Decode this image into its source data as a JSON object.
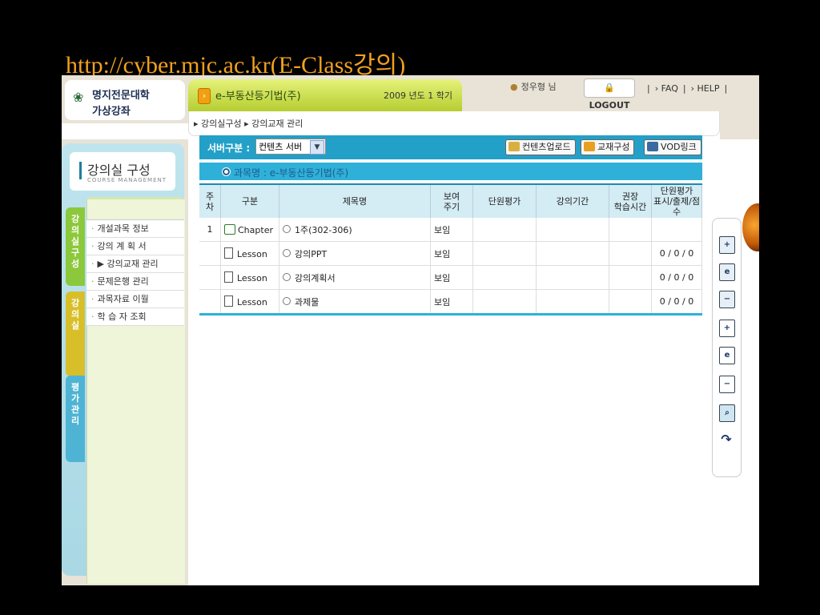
{
  "slide_title": "http://cyber.mjc.ac.kr(E-Class강의)",
  "logo": {
    "line1": "명지전문대학",
    "line2": "가상강좌"
  },
  "course": {
    "name": "e-부동산등기법(주)",
    "semester": "2009 년도 1 학기"
  },
  "user": {
    "name": "정우형 님"
  },
  "header_links": {
    "logout": "LOGOUT",
    "faq": "› FAQ",
    "help": "› HELP"
  },
  "breadcrumb": "▸ 강의실구성 ▸ 강의교재 관리",
  "sidebar": {
    "title": "강의실 구성",
    "subtitle": "COURSE MANAGEMENT",
    "vtabs": [
      "강의실구성",
      "강의실",
      "평가관리"
    ],
    "items": [
      "개설과목 정보",
      "강의 계 획 서",
      "▶ 강의교재 관리",
      "문제은행 관리",
      "과목자료 이월",
      "학 습 자 조회"
    ]
  },
  "server": {
    "label": "서버구분 :",
    "selected": "컨텐츠 서버"
  },
  "buttons": {
    "upload": "컨텐츠업로드",
    "compose": "교재구성",
    "vod": "VOD링크"
  },
  "subject": "과목명 : e-부동산등기법(주)",
  "table": {
    "headers": [
      "주\n차",
      "구분",
      "제목명",
      "보여\n주기",
      "단원평가",
      "강의기간",
      "권장\n학습시간",
      "단원평가\n표시/출제/점수"
    ],
    "rows": [
      {
        "week": "1",
        "type": "Chapter",
        "title": "1주(302-306)",
        "show": "보임",
        "score": ""
      },
      {
        "week": "",
        "type": "Lesson",
        "title": "강의PPT",
        "show": "보임",
        "score": "0 / 0 / 0"
      },
      {
        "week": "",
        "type": "Lesson",
        "title": "강의계획서",
        "show": "보임",
        "score": "0 / 0 / 0"
      },
      {
        "week": "",
        "type": "Lesson",
        "title": "과제물",
        "show": "보임",
        "score": "0 / 0 / 0"
      }
    ]
  },
  "tools": [
    "folder-add-icon",
    "folder-edit-icon",
    "folder-remove-icon",
    "doc-add-icon",
    "doc-edit-icon",
    "doc-remove-icon",
    "preview-icon",
    "refresh-icon"
  ]
}
